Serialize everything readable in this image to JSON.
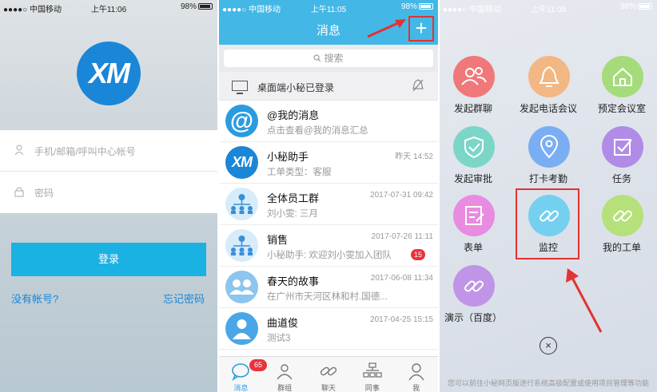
{
  "status_left": {
    "carrier": "●●●●○ 中国移动",
    "time": "上午11:06",
    "battery": "98%"
  },
  "status_mid": {
    "carrier": "●●●●○ 中国移动",
    "time": "上午11:05",
    "battery": "98%"
  },
  "status_right": {
    "carrier": "●●●●○ 中国移动",
    "time": "上午11:05",
    "battery": "98%"
  },
  "login": {
    "logo": "XM",
    "account_placeholder": "手机/邮箱/呼叫中心帐号",
    "password_placeholder": "密码",
    "login_button": "登录",
    "no_account_link": "没有帐号?",
    "forgot_link": "忘记密码"
  },
  "messages": {
    "title": "消息",
    "add_button": "+",
    "search_placeholder": "搜索",
    "desktop_notice": "桌面端小秘已登录",
    "items": [
      {
        "name": "@我的消息",
        "subtitle": "点击查看@我的消息汇总",
        "time": "",
        "badge": "",
        "avatar": "@"
      },
      {
        "name": "小秘助手",
        "subtitle": "工单类型：客服",
        "time": "昨天 14:52",
        "badge": "",
        "avatar": "XM"
      },
      {
        "name": "全体员工群",
        "subtitle": "刘小雯: 三月",
        "time": "2017-07-31 09:42",
        "badge": "",
        "avatar": ""
      },
      {
        "name": "销售",
        "subtitle": "小秘助手: 欢迎刘小雯加入团队",
        "time": "2017-07-26 11:11",
        "badge": "15",
        "avatar": ""
      },
      {
        "name": "春天的故事",
        "subtitle": "在广州市天河区林和村.国德...",
        "time": "2017-06-08 11:34",
        "badge": "",
        "avatar": ""
      },
      {
        "name": "曲道俊",
        "subtitle": "测试3",
        "time": "2017-04-25 15:15",
        "badge": "",
        "avatar": ""
      }
    ],
    "tabs": [
      {
        "label": "消息",
        "badge": "65"
      },
      {
        "label": "群组",
        "badge": ""
      },
      {
        "label": "聊天",
        "badge": ""
      },
      {
        "label": "同事",
        "badge": ""
      },
      {
        "label": "我",
        "badge": ""
      }
    ]
  },
  "menu": {
    "items": [
      {
        "label": "发起群聊",
        "color": "#f0787a"
      },
      {
        "label": "发起电话会议",
        "color": "#f2b782"
      },
      {
        "label": "预定会议室",
        "color": "#a6db7c"
      },
      {
        "label": "发起审批",
        "color": "#7bd6c8"
      },
      {
        "label": "打卡考勤",
        "color": "#7aaef2"
      },
      {
        "label": "任务",
        "color": "#b18ce6"
      },
      {
        "label": "表单",
        "color": "#e98be0"
      },
      {
        "label": "监控",
        "color": "#74d0ee"
      },
      {
        "label": "我的工单",
        "color": "#b5e07a"
      },
      {
        "label": "演示（百度）",
        "color": "#c094e6"
      }
    ],
    "close": "×",
    "footer_note": "您可以前往小秘网页版进行系统高级配置或使用项目管理等功能"
  }
}
